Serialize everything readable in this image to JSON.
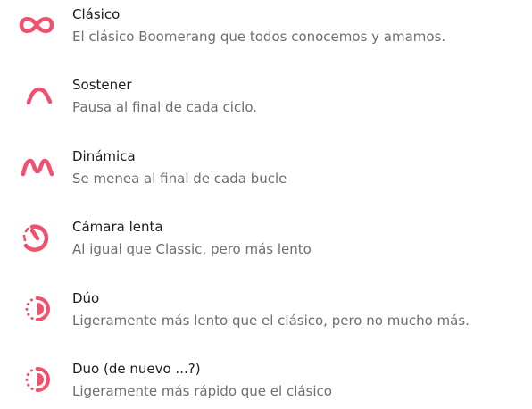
{
  "modes": [
    {
      "icon": "infinity-icon",
      "title": "Clásico",
      "description": "El clásico Boomerang que todos conocemos y amamos."
    },
    {
      "icon": "hold-wave-icon",
      "title": "Sostener",
      "description": "Pausa al final de cada ciclo."
    },
    {
      "icon": "wiggle-wave-icon",
      "title": "Dinámica",
      "description": "Se menea al final de cada bucle"
    },
    {
      "icon": "slow-motion-gauge-icon",
      "title": "Cámara lenta",
      "description": "Al igual que Classic, pero más lento"
    },
    {
      "icon": "duo-timer-icon",
      "title": "Dúo",
      "description": "Ligeramente más lento que el clásico, pero no mucho más."
    },
    {
      "icon": "duo-timer-icon",
      "title": "Duo (de nuevo ...?)",
      "description": "Ligeramente más rápido que el clásico"
    }
  ],
  "colors": {
    "accent": "#f1506f",
    "title_text": "#1c1c1c",
    "description_text": "#6e6e6e"
  }
}
